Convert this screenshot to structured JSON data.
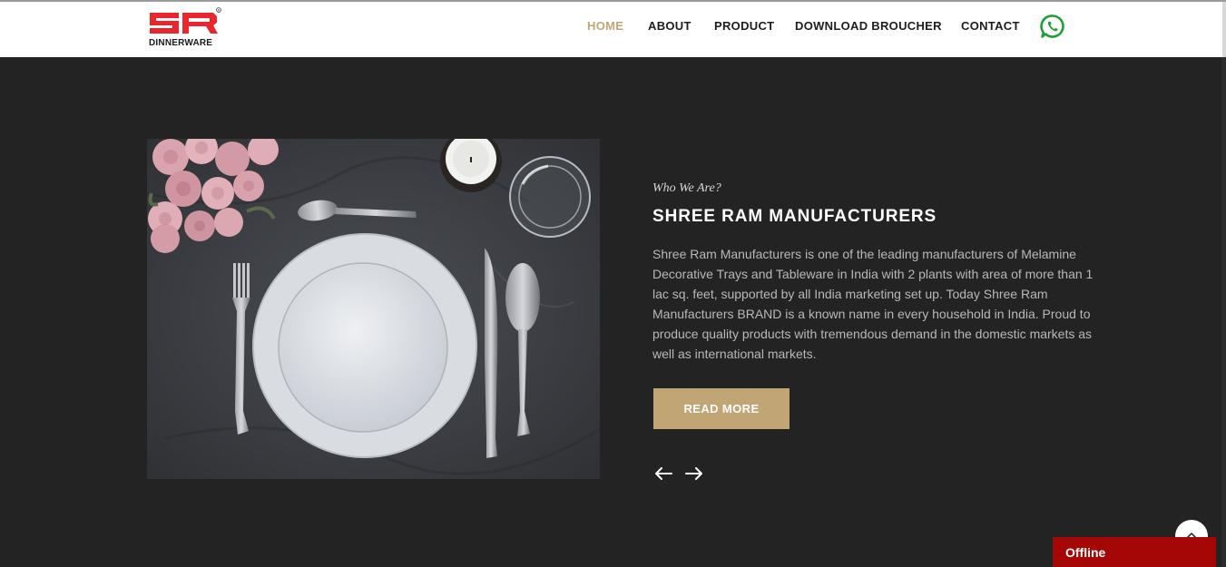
{
  "brand": {
    "logo_mark": "SR",
    "logo_text": "DINNERWARE",
    "registered_mark": "®",
    "primary_color": "#e8262c",
    "accent_color": "#c2a574"
  },
  "nav": {
    "items": [
      {
        "label": "HOME",
        "active": true
      },
      {
        "label": "ABOUT",
        "active": false
      },
      {
        "label": "PRODUCT",
        "active": false
      },
      {
        "label": "DOWNLOAD BROUCHER",
        "active": false
      },
      {
        "label": "CONTACT",
        "active": false
      }
    ],
    "whatsapp_icon": "whatsapp-icon",
    "whatsapp_color": "#1fa037"
  },
  "about": {
    "subtitle": "Who We Are?",
    "title": "SHREE RAM MANUFACTURERS",
    "description": "Shree Ram Manufacturers is one of the leading manufacturers of Melamine Decorative Trays and Tableware in India with 2 plants with area of more than 1 lac sq. feet, supported by all India marketing set up. Today Shree Ram Manufacturers BRAND is a known name in every household in India. Proud to produce quality products with tremendous demand in the domestic markets as well as international markets.",
    "button_label": "READ MORE",
    "prev_icon": "arrow-left-icon",
    "next_icon": "arrow-right-icon",
    "image_icon": "table-setting-photo"
  },
  "widgets": {
    "scroll_top_icon": "chevron-up-icon",
    "chat_status": "Offline",
    "chat_color": "#a50606"
  }
}
